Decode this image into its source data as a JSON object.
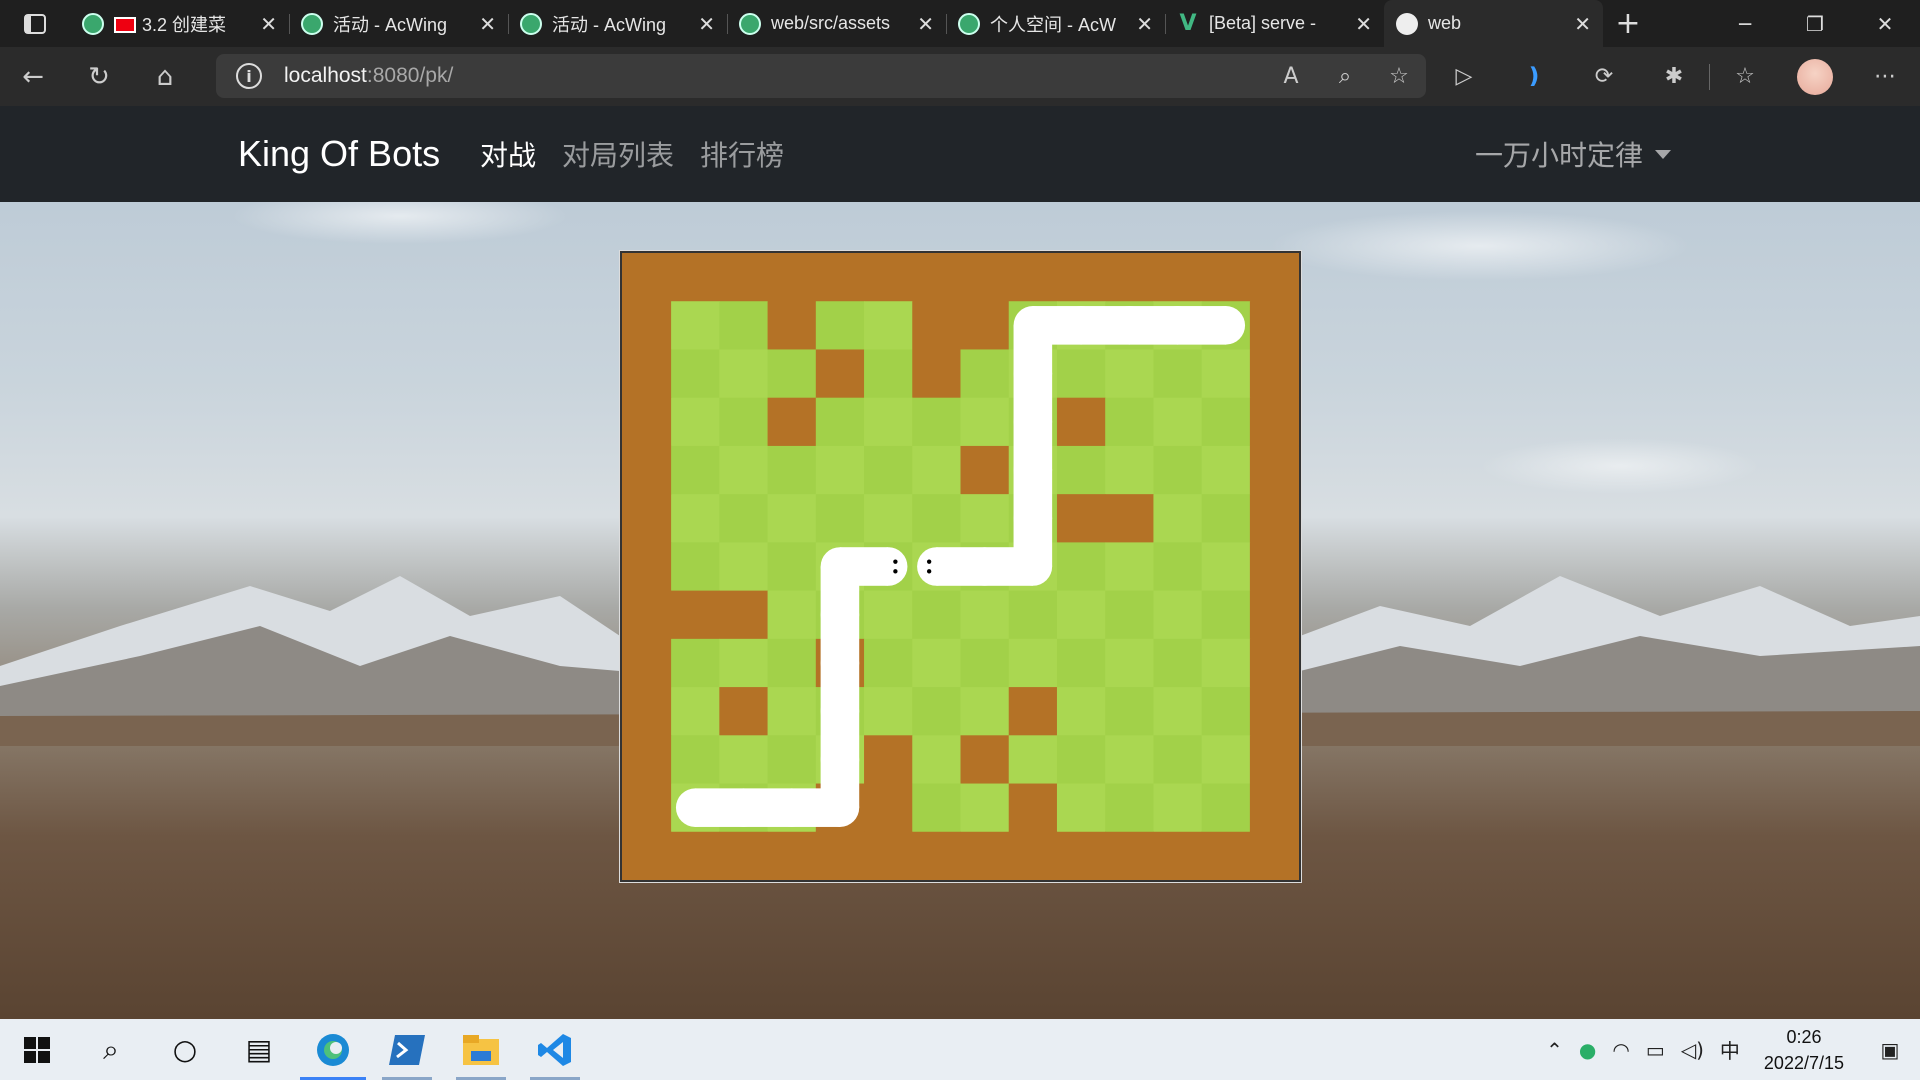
{
  "browser": {
    "tabs": [
      {
        "title": "3.2 创建菜",
        "icon": "acwing-favicon-icon",
        "has_red_mark": true,
        "active": false
      },
      {
        "title": "活动 - AcWing",
        "icon": "acwing-favicon-icon",
        "active": false
      },
      {
        "title": "活动 - AcWing",
        "icon": "acwing-favicon-icon",
        "active": false
      },
      {
        "title": "web/src/assets",
        "icon": "acwing-favicon-icon",
        "active": false
      },
      {
        "title": "个人空间 - AcW",
        "icon": "acwing-favicon-icon",
        "active": false
      },
      {
        "title": "[Beta] serve - ",
        "icon": "vue-favicon-icon",
        "active": false
      },
      {
        "title": "web",
        "icon": "web-favicon-icon",
        "active": true
      }
    ],
    "close_glyph": "✕",
    "new_tab_glyph": "+",
    "url_host": "localhost",
    "url_rest": ":8080/pk/"
  },
  "navbar": {
    "brand": "King Of Bots",
    "links": [
      {
        "label": "对战",
        "active": true
      },
      {
        "label": "对局列表",
        "active": false
      },
      {
        "label": "排行榜",
        "active": false
      }
    ],
    "user": "一万小时定律"
  },
  "game": {
    "rows": 13,
    "cols": 14,
    "colors": {
      "wall": "#b47226",
      "grass_light": "#aad751",
      "grass_dark": "#a2d149",
      "snake": "#ffffff",
      "eye": "#000000"
    },
    "walls": [
      [
        1,
        3
      ],
      [
        1,
        6
      ],
      [
        1,
        7
      ],
      [
        2,
        4
      ],
      [
        2,
        6
      ],
      [
        3,
        3
      ],
      [
        3,
        9
      ],
      [
        4,
        7
      ],
      [
        5,
        9
      ],
      [
        5,
        10
      ],
      [
        7,
        1
      ],
      [
        7,
        2
      ],
      [
        8,
        4
      ],
      [
        9,
        2
      ],
      [
        9,
        8
      ],
      [
        10,
        5
      ],
      [
        10,
        7
      ],
      [
        11,
        4
      ],
      [
        11,
        5
      ],
      [
        11,
        8
      ]
    ],
    "snakes": [
      {
        "color": "#ffffff",
        "cells": [
          [
            6,
            5
          ],
          [
            6,
            4
          ],
          [
            7,
            4
          ],
          [
            8,
            4
          ],
          [
            9,
            4
          ],
          [
            10,
            4
          ],
          [
            11,
            4
          ],
          [
            11,
            3
          ],
          [
            11,
            2
          ],
          [
            11,
            1
          ]
        ],
        "head_dir": "right"
      },
      {
        "color": "#ffffff",
        "cells": [
          [
            6,
            6
          ],
          [
            6,
            7
          ],
          [
            6,
            8
          ],
          [
            5,
            8
          ],
          [
            4,
            8
          ],
          [
            3,
            8
          ],
          [
            2,
            8
          ],
          [
            1,
            8
          ],
          [
            1,
            9
          ],
          [
            1,
            10
          ],
          [
            1,
            11
          ],
          [
            1,
            12
          ]
        ],
        "head_dir": "left"
      }
    ]
  },
  "taskbar": {
    "apps": [
      {
        "name": "edge-icon",
        "state": "active"
      },
      {
        "name": "powershell-icon",
        "state": "opened"
      },
      {
        "name": "file-explorer-icon",
        "state": "opened"
      },
      {
        "name": "vscode-icon",
        "state": "opened"
      }
    ],
    "ime": "中",
    "time": "0:26",
    "date": "2022/7/15"
  }
}
